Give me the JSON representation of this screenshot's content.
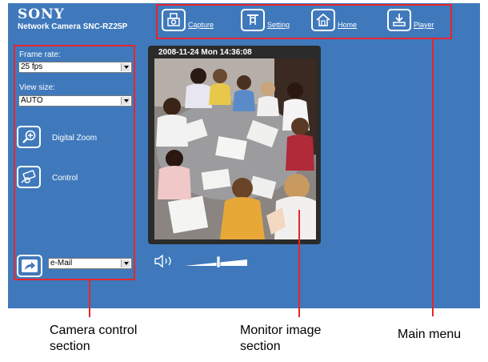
{
  "brand": {
    "logo": "SONY",
    "model": "Network Camera SNC-RZ25P"
  },
  "main_menu": {
    "capture": "Capture",
    "setting": "Setting",
    "home": "Home",
    "player": "Player"
  },
  "controls": {
    "frame_rate_label": "Frame rate:",
    "frame_rate_value": "25 fps",
    "view_size_label": "View size:",
    "view_size_value": "AUTO",
    "digital_zoom": "Digital Zoom",
    "control": "Control",
    "send_value": "e-Mail"
  },
  "monitor": {
    "timestamp": "2008-11-24 Mon 14:36:08"
  },
  "callouts": {
    "camera_control_1": "Camera control",
    "camera_control_2": "section",
    "monitor_image_1": "Monitor image",
    "monitor_image_2": "section",
    "main_menu": "Main menu"
  },
  "colors": {
    "panel_blue": "#3f79bc",
    "highlight_red": "#e8252c"
  }
}
